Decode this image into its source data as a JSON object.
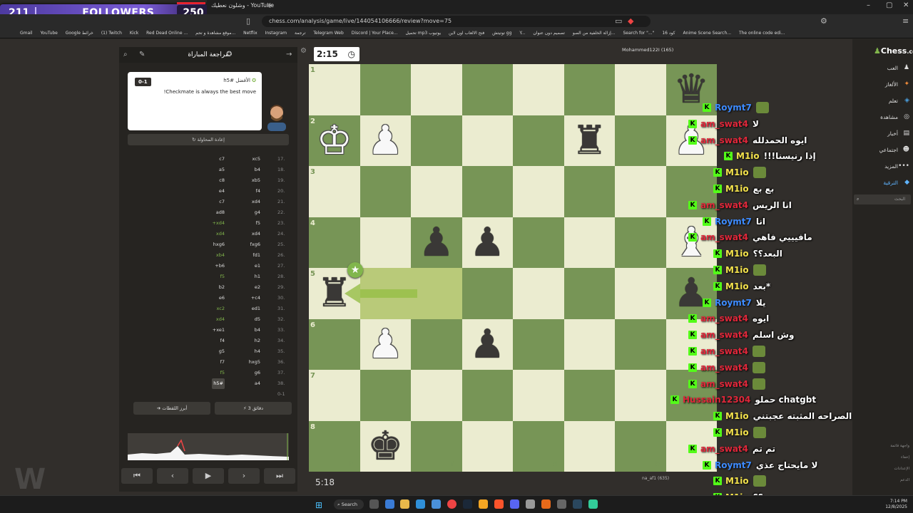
{
  "stream": {
    "followers_count": "211",
    "followers_label": "FOLLOWERS",
    "followers_goal": "250"
  },
  "browser": {
    "tab_title": "وشلون نعطيك - YouTube",
    "new_tab": "+",
    "url": "chess.com/analysis/game/live/144054106666/review?move=75",
    "bookmarks": [
      "Gmail",
      "YouTube",
      "Google خرائط",
      "(1) Twitch",
      "Kick",
      "Red Dead Online ...",
      "موقع مشاهدة و تحم...",
      "Netflix",
      "Instagram",
      "ترجمة",
      "Telegram Web",
      "Discord | Your Place...",
      "تحميل mp3 يوتيوب",
      "فتح الالعاب اون لاين",
      "توتيتش gg",
      "Y...",
      "تصميم دون عنوان",
      "إزالة الخلفية من الصو...",
      "Search for \"...\"",
      "كود 16",
      "Anime Scene Search...",
      "The online code edi..."
    ]
  },
  "review": {
    "title": "مراجعة المباراة",
    "score": "0-1",
    "best_move": "h5# الأفضل",
    "message": "!Checkmate is always the best move",
    "retry": "إعادة المحاولة",
    "key_moments": "أبرز اللقطات",
    "minutes": "3 دقائق",
    "moves": [
      {
        "n": "17.",
        "w": "xc5",
        "b": "c7"
      },
      {
        "n": "18.",
        "w": "b4",
        "b": "a5"
      },
      {
        "n": "19.",
        "w": "xb5",
        "b": "c8"
      },
      {
        "n": "20.",
        "w": "f4",
        "b": "e4"
      },
      {
        "n": "21.",
        "w": "xd4",
        "b": "c7"
      },
      {
        "n": "22.",
        "w": "g4",
        "b": "ad8"
      },
      {
        "n": "23.",
        "w": "f5",
        "b": "+xd4"
      },
      {
        "n": "24.",
        "w": "xd4",
        "b": "xd4"
      },
      {
        "n": "25.",
        "w": "fxg6",
        "b": "hxg6"
      },
      {
        "n": "26.",
        "w": "fd1",
        "b": "xb4"
      },
      {
        "n": "27.",
        "w": "e1",
        "b": "+b6"
      },
      {
        "n": "28.",
        "w": "h1",
        "b": "f5"
      },
      {
        "n": "29.",
        "w": "e2",
        "b": "b2"
      },
      {
        "n": "30.",
        "w": "+c4",
        "b": "e6"
      },
      {
        "n": "31.",
        "w": "ed1",
        "b": "xc2"
      },
      {
        "n": "32.",
        "w": "d5",
        "b": "xd4"
      },
      {
        "n": "33.",
        "w": "b4",
        "b": "+xe1"
      },
      {
        "n": "34.",
        "w": "h2",
        "b": "f4"
      },
      {
        "n": "35.",
        "w": "h4",
        "b": "g5"
      },
      {
        "n": "36.",
        "w": "hxg5",
        "b": "f7"
      },
      {
        "n": "37.",
        "w": "g6",
        "b": "f5"
      },
      {
        "n": "38.",
        "w": "a4",
        "b": "h5#"
      },
      {
        "n": "0-1",
        "w": "",
        "b": ""
      }
    ]
  },
  "board": {
    "clock_top": "2:15",
    "clock_bottom": "5:18",
    "player_top": "Mohammed122I (165)",
    "player_bottom": "na_af1 (635)",
    "ranks": [
      "1",
      "2",
      "3",
      "4",
      "5",
      "6",
      "7",
      "8"
    ],
    "files": [
      "h",
      "g",
      "f",
      "e",
      "d",
      "c",
      "b"
    ]
  },
  "chat": [
    {
      "user": "Roymt7",
      "color": "#3d8bff",
      "text": "",
      "emote": true
    },
    {
      "user": "am_swat4",
      "color": "#e0273a",
      "text": "لا"
    },
    {
      "user": "am_swat4",
      "color": "#e0273a",
      "text": "ايوه الحمدلله"
    },
    {
      "user": "M1io",
      "color": "#f2e14b",
      "text": "!!!إذا رنيسنا"
    },
    {
      "user": "M1io",
      "color": "#f2e14b",
      "text": "",
      "emote": true
    },
    {
      "user": "M1io",
      "color": "#f2e14b",
      "text": "بع بع"
    },
    {
      "user": "am_swat4",
      "color": "#e0273a",
      "text": "انا الريس"
    },
    {
      "user": "Roymt7",
      "color": "#3d8bff",
      "text": "انا"
    },
    {
      "user": "am_swat4",
      "color": "#e0273a",
      "text": "مافيييي فاهي"
    },
    {
      "user": "M1io",
      "color": "#f2e14b",
      "text": "البعد؟؟"
    },
    {
      "user": "M1io",
      "color": "#f2e14b",
      "text": "",
      "emote": true
    },
    {
      "user": "M1io",
      "color": "#f2e14b",
      "text": "بعد*"
    },
    {
      "user": "Roymt7",
      "color": "#3d8bff",
      "text": "يلا"
    },
    {
      "user": "am_swat4",
      "color": "#e0273a",
      "text": "ايوه"
    },
    {
      "user": "am_swat4",
      "color": "#e0273a",
      "text": "وش اسلم"
    },
    {
      "user": "am_swat4",
      "color": "#e0273a",
      "text": "",
      "emote": true
    },
    {
      "user": "am_swat4",
      "color": "#e0273a",
      "text": "",
      "emote": true
    },
    {
      "user": "am_swat4",
      "color": "#e0273a",
      "text": "",
      "emote": true
    },
    {
      "user": "Hussain12304",
      "color": "#e0273a",
      "text": "حملو chatgbt"
    },
    {
      "user": "M1io",
      "color": "#f2e14b",
      "text": "الصراحه المثبته عجبتني"
    },
    {
      "user": "M1io",
      "color": "#f2e14b",
      "text": "",
      "emote": true
    },
    {
      "user": "am_swat4",
      "color": "#e0273a",
      "text": "تم تم"
    },
    {
      "user": "Roymt7",
      "color": "#3d8bff",
      "text": "لا مايحتاج عذي"
    },
    {
      "user": "M1io",
      "color": "#f2e14b",
      "text": "",
      "emote": true
    },
    {
      "user": "M1io",
      "color": "#f2e14b",
      "text": "؟؟"
    }
  ],
  "sidebar": {
    "logo_a": "Chess",
    "logo_b": ".com",
    "items": [
      "العب",
      "الألغاز",
      "تعلم",
      "مشاهدة",
      "أخبار",
      "اجتماعي",
      "المزيد",
      "الترقية"
    ],
    "search_placeholder": "البحث",
    "footer": [
      "واجهة قاتمة",
      "إخفاء",
      "الإعدادات",
      "الدعم"
    ]
  },
  "taskbar": {
    "search": "Search",
    "time": "7:14 PM",
    "date": "12/8/2025"
  }
}
